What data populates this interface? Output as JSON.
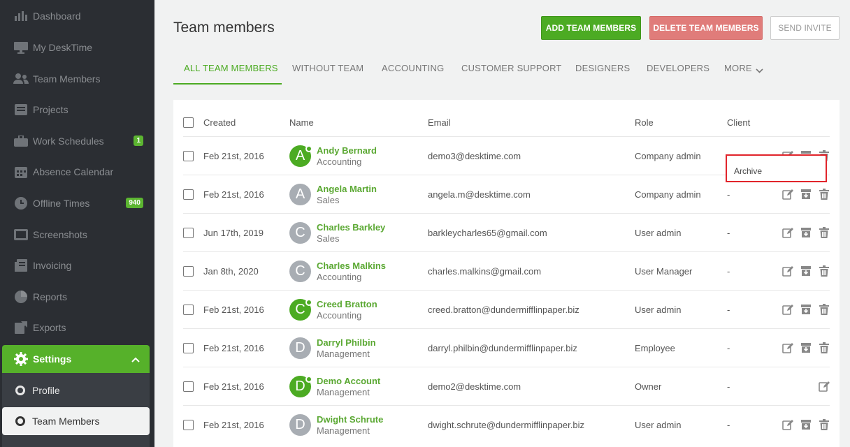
{
  "sidebar": {
    "items": [
      {
        "label": "Dashboard",
        "icon": "bar-chart-icon"
      },
      {
        "label": "My DeskTime",
        "icon": "monitor-icon"
      },
      {
        "label": "Team Members",
        "icon": "users-icon"
      },
      {
        "label": "Projects",
        "icon": "folder-icon"
      },
      {
        "label": "Work Schedules",
        "icon": "briefcase-icon",
        "badge": "1"
      },
      {
        "label": "Absence Calendar",
        "icon": "calendar-icon"
      },
      {
        "label": "Offline Times",
        "icon": "clock-icon",
        "badge": "940"
      },
      {
        "label": "Screenshots",
        "icon": "screenshot-icon"
      },
      {
        "label": "Invoicing",
        "icon": "invoice-icon"
      },
      {
        "label": "Reports",
        "icon": "pie-chart-icon"
      },
      {
        "label": "Exports",
        "icon": "export-icon"
      }
    ],
    "settings_label": "Settings",
    "sub_items": [
      {
        "label": "Profile"
      },
      {
        "label": "Team Members"
      }
    ]
  },
  "header": {
    "title": "Team members",
    "add_label": "ADD TEAM MEMBERS",
    "delete_label": "DELETE TEAM MEMBERS",
    "invite_label": "SEND INVITE"
  },
  "tabs": [
    {
      "label": "ALL TEAM MEMBERS"
    },
    {
      "label": "WITHOUT TEAM"
    },
    {
      "label": "ACCOUNTING"
    },
    {
      "label": "CUSTOMER SUPPORT"
    },
    {
      "label": "DESIGNERS"
    },
    {
      "label": "DEVELOPERS"
    },
    {
      "label": "MORE"
    }
  ],
  "table": {
    "headers": {
      "created": "Created",
      "name": "Name",
      "email": "Email",
      "role": "Role",
      "client": "Client"
    },
    "rows": [
      {
        "created": "Feb 21st, 2016",
        "initial": "A",
        "name": "Andy Bernard",
        "team": "Accounting",
        "email": "demo3@desktime.com",
        "role": "Company admin",
        "client": "",
        "online": true
      },
      {
        "created": "Feb 21st, 2016",
        "initial": "A",
        "name": "Angela Martin",
        "team": "Sales",
        "email": "angela.m@desktime.com",
        "role": "Company admin",
        "client": "-",
        "online": false
      },
      {
        "created": "Jun 17th, 2019",
        "initial": "C",
        "name": "Charles Barkley",
        "team": "Sales",
        "email": "barkleycharles65@gmail.com",
        "role": "User admin",
        "client": "-",
        "online": false
      },
      {
        "created": "Jan 8th, 2020",
        "initial": "C",
        "name": "Charles Malkins",
        "team": "Accounting",
        "email": "charles.malkins@gmail.com",
        "role": "User Manager",
        "client": "-",
        "online": false
      },
      {
        "created": "Feb 21st, 2016",
        "initial": "C",
        "name": "Creed Bratton",
        "team": "Accounting",
        "email": "creed.bratton@dundermifflinpaper.biz",
        "role": "User admin",
        "client": "-",
        "online": true
      },
      {
        "created": "Feb 21st, 2016",
        "initial": "D",
        "name": "Darryl Philbin",
        "team": "Management",
        "email": "darryl.philbin@dundermifflinpaper.biz",
        "role": "Employee",
        "client": "-",
        "online": false
      },
      {
        "created": "Feb 21st, 2016",
        "initial": "D",
        "name": "Demo Account",
        "team": "Management",
        "email": "demo2@desktime.com",
        "role": "Owner",
        "client": "-",
        "online": true
      },
      {
        "created": "Feb 21st, 2016",
        "initial": "D",
        "name": "Dwight Schrute",
        "team": "Management",
        "email": "dwight.schrute@dundermifflinpaper.biz",
        "role": "User admin",
        "client": "-",
        "online": false
      }
    ]
  },
  "tooltip": {
    "label": "Archive"
  },
  "colors": {
    "accent": "#4cab23",
    "sidebar": "#2b2e33",
    "danger": "#e07c7a",
    "highlight": "#e1242b"
  }
}
